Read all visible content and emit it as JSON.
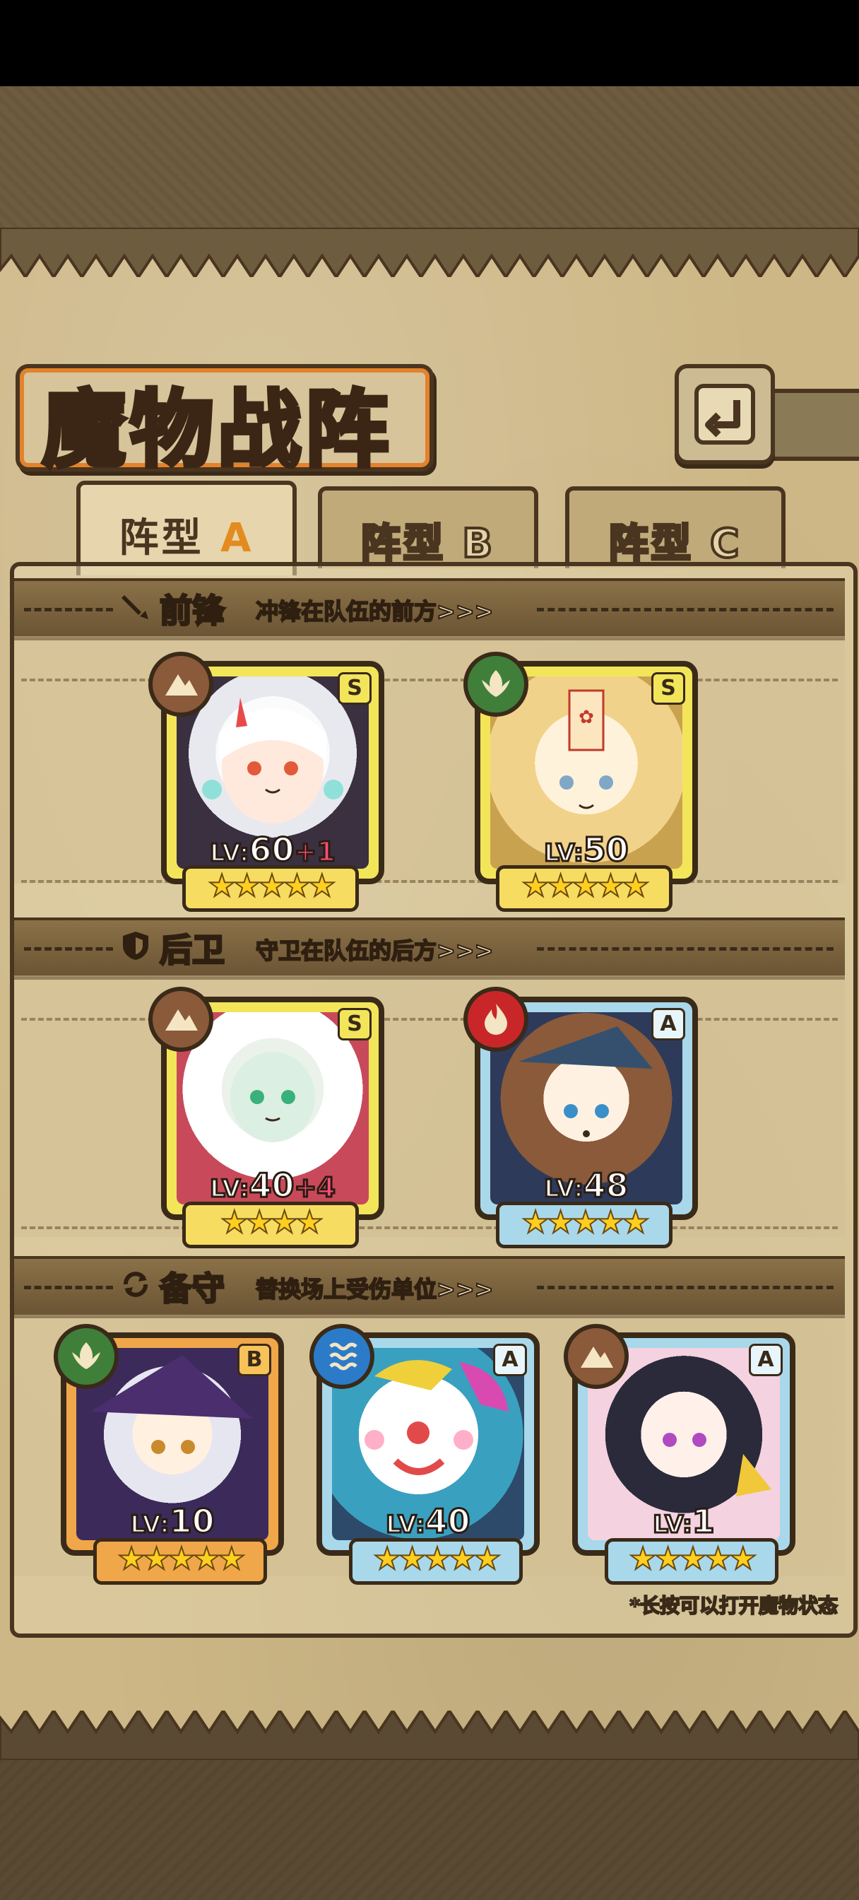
{
  "title": "魔物战阵",
  "back_icon": "back-arrow-icon",
  "tabs": [
    {
      "label_main": "阵型",
      "label_letter": "A",
      "active": true
    },
    {
      "label_main": "阵型",
      "label_letter": "B",
      "active": false
    },
    {
      "label_main": "阵型",
      "label_letter": "C",
      "active": false
    }
  ],
  "sections": {
    "front": {
      "title": "前锋",
      "subtitle": "冲锋在队伍的前方>>>",
      "icon": "sword-icon"
    },
    "back": {
      "title": "后卫",
      "subtitle": "守卫在队伍的后方>>>",
      "icon": "shield-icon"
    },
    "reserve": {
      "title": "备守",
      "subtitle": "替换场上受伤单位>>>",
      "icon": "swap-icon"
    }
  },
  "units": {
    "front": [
      {
        "rank": "S",
        "lv_tag": "LV:",
        "level": "60",
        "plus": "+1",
        "stars": 5,
        "element": "earth",
        "element_color": "#8a5a3a"
      },
      {
        "rank": "S",
        "lv_tag": "LV:",
        "level": "50",
        "plus": "",
        "stars": 5,
        "element": "leaf",
        "element_color": "#3f7f3a"
      }
    ],
    "back": [
      {
        "rank": "S",
        "lv_tag": "LV:",
        "level": "40",
        "plus": "+4",
        "stars": 4,
        "element": "earth",
        "element_color": "#8a5a3a"
      },
      {
        "rank": "A",
        "lv_tag": "LV:",
        "level": "48",
        "plus": "",
        "stars": 5,
        "element": "fire",
        "element_color": "#c9262a"
      }
    ],
    "reserve": [
      {
        "rank": "B",
        "lv_tag": "LV:",
        "level": "10",
        "plus": "",
        "stars": 5,
        "element": "leaf",
        "element_color": "#3f7f3a"
      },
      {
        "rank": "A",
        "lv_tag": "LV:",
        "level": "40",
        "plus": "",
        "stars": 5,
        "element": "water",
        "element_color": "#2b7bc9"
      },
      {
        "rank": "A",
        "lv_tag": "LV:",
        "level": "1",
        "plus": "",
        "stars": 5,
        "element": "earth",
        "element_color": "#8a5a3a"
      }
    ]
  },
  "hint": "*长按可以打开魔物状态"
}
